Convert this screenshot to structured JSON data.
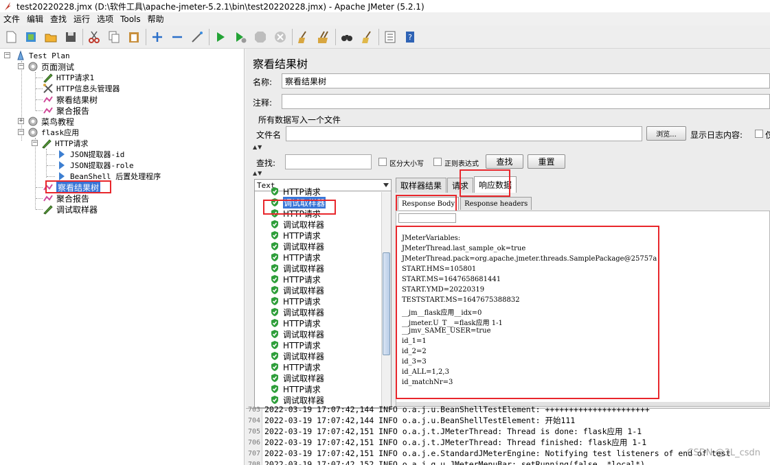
{
  "window": {
    "title": "test20220228.jmx (D:\\软件工具\\apache-jmeter-5.2.1\\bin\\test20220228.jmx) - Apache JMeter (5.2.1)"
  },
  "menu": [
    "文件",
    "编辑",
    "查找",
    "运行",
    "选项",
    "Tools",
    "帮助"
  ],
  "tree": {
    "test_plan": "Test Plan",
    "group_page": "页面测试",
    "http_req_1": "HTTP请求1",
    "http_header": "HTTP信息头管理器",
    "view_tree_1": "察看结果树",
    "agg_report_1": "聚合报告",
    "group_cainiao": "菜鸟教程",
    "group_flask": "flask应用",
    "http_req": "HTTP请求",
    "json_id": "JSON提取器-id",
    "json_role": "JSON提取器-role",
    "beanshell": "BeanShell 后置处理程序",
    "view_tree_2": "察看结果树",
    "agg_report_2": "聚合报告",
    "debug_sampler": "调试取样器"
  },
  "panel": {
    "title": "察看结果树",
    "name_label": "名称:",
    "name_value": "察看结果树",
    "comment_label": "注释:",
    "comment_value": "",
    "file_group": "所有数据写入一个文件",
    "filename_label": "文件名",
    "filename_value": "",
    "browse": "浏览...",
    "log_content": "显示日志内容:",
    "log_content_trail": "仅",
    "search_label": "查找:",
    "case_sensitive": "区分大小写",
    "regex": "正则表达式",
    "find_btn": "查找",
    "reset_btn": "重置"
  },
  "renderer": "Text",
  "results": [
    "HTTP请求",
    "调试取样器",
    "HTTP请求",
    "调试取样器",
    "HTTP请求",
    "调试取样器",
    "HTTP请求",
    "调试取样器",
    "HTTP请求",
    "调试取样器",
    "HTTP请求",
    "调试取样器",
    "HTTP请求",
    "调试取样器",
    "HTTP请求",
    "调试取样器",
    "HTTP请求",
    "调试取样器",
    "HTTP请求",
    "调试取样器"
  ],
  "tabs": [
    "取样器结果",
    "请求",
    "响应数据"
  ],
  "subtabs": [
    "Response Body",
    "Response headers"
  ],
  "response_lines": [
    "JMeterVariables:",
    "JMeterThread.last_sample_ok=true",
    "JMeterThread.pack=org.apache.jmeter.threads.SamplePackage@25757a",
    "START.HMS=105801",
    "START.MS=1647658681441",
    "START.YMD=20220319",
    "TESTSTART.MS=1647675388832",
    "__jm__flask应用__idx=0",
    "__jmeter.U_T__=flask应用 1-1",
    "__jmv_SAME_USER=true",
    "id_1=1",
    "id_2=2",
    "id_3=3",
    "id_ALL=1,2,3",
    "id_matchNr=3"
  ],
  "log_lines": [
    {
      "num": "703",
      "text": "2022-03-19 17:07:42,144 INFO o.a.j.u.BeanShellTestElement: ++++++++++++++++++++++"
    },
    {
      "num": "704",
      "text": "2022-03-19 17:07:42,144 INFO o.a.j.u.BeanShellTestElement: 开始111"
    },
    {
      "num": "705",
      "text": "2022-03-19 17:07:42,151 INFO o.a.j.t.JMeterThread: Thread is done: flask应用 1-1"
    },
    {
      "num": "706",
      "text": "2022-03-19 17:07:42,151 INFO o.a.j.t.JMeterThread: Thread finished: flask应用 1-1"
    },
    {
      "num": "707",
      "text": "2022-03-19 17:07:42,151 INFO o.a.j.e.StandardJMeterEngine: Notifying test listeners of end of test"
    },
    {
      "num": "708",
      "text": "2022-03-19 17:07:42,152 INFO o.a.j.g.u.JMeterMenuBar: setRunning(false, *local*)"
    }
  ],
  "watermark": "CSDN @3L_csdn",
  "colors": {
    "highlight": "#e8262b",
    "selection": "#3875d7",
    "ok_green": "#2e9e3a"
  }
}
